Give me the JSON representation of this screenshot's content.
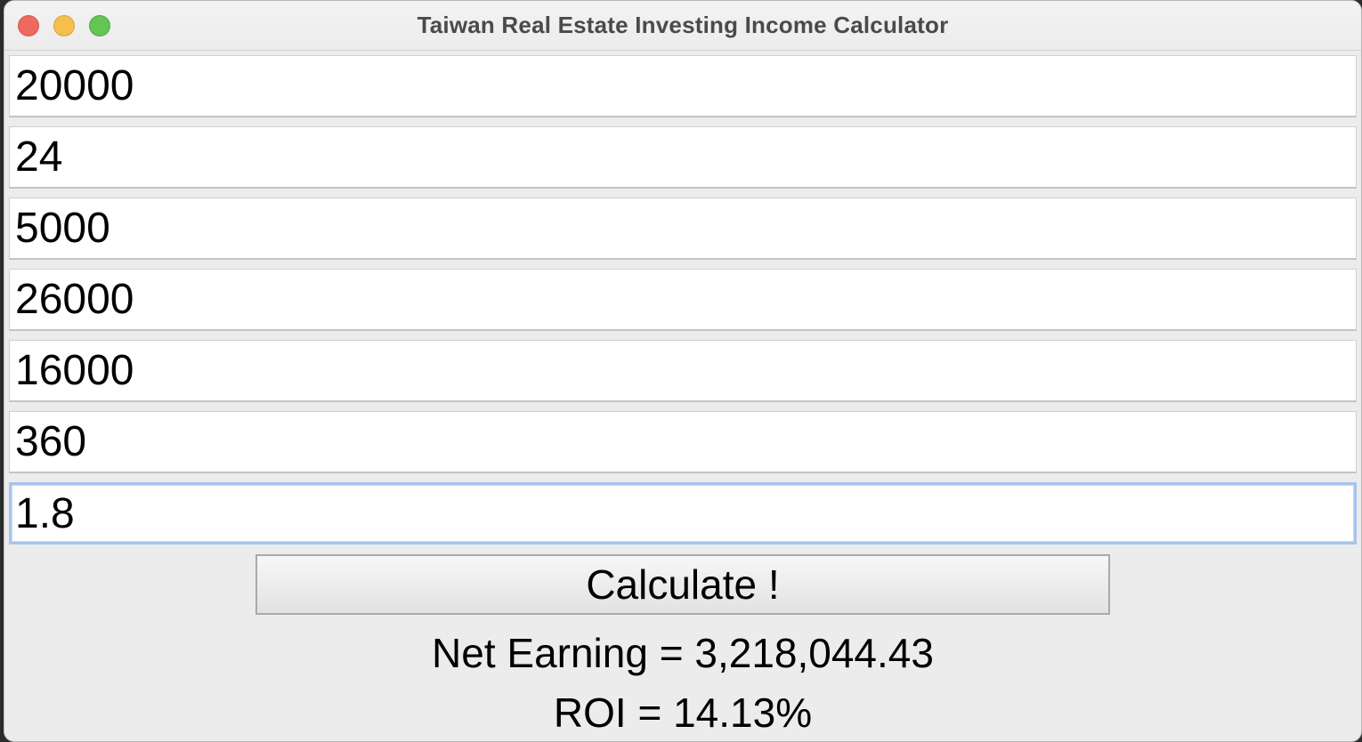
{
  "window": {
    "title": "Taiwan Real Estate Investing Income Calculator"
  },
  "inputs": [
    {
      "value": "20000"
    },
    {
      "value": "24"
    },
    {
      "value": "5000"
    },
    {
      "value": "26000"
    },
    {
      "value": "16000"
    },
    {
      "value": "360"
    },
    {
      "value": "1.8"
    }
  ],
  "actions": {
    "calculate_label": "Calculate !"
  },
  "results": {
    "net_earning": "Net Earning = 3,218,044.43",
    "roi": "ROI = 14.13%"
  },
  "colors": {
    "close": "#ee6a5e",
    "minimize": "#f5bf4f",
    "maximize": "#62c554",
    "focus_ring": "#a9c4ec"
  }
}
